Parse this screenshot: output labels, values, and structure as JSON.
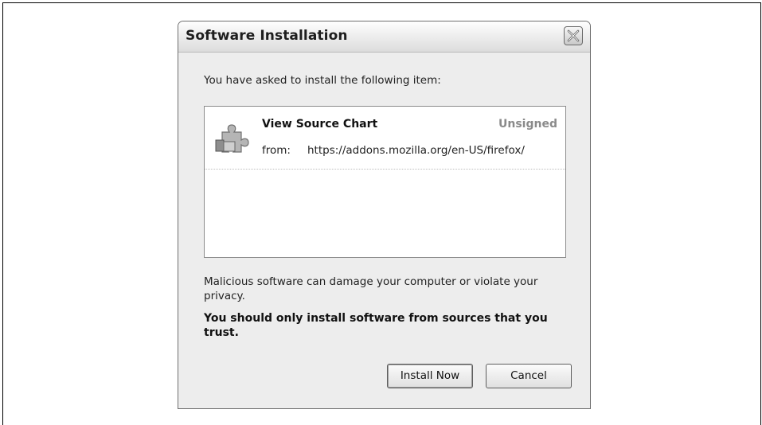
{
  "dialog": {
    "title": "Software Installation",
    "intro": "You have asked to install the following item:",
    "item": {
      "icon": "puzzle-piece-icon",
      "name": "View Source Chart",
      "status": "Unsigned",
      "from_label": "from:",
      "from_url": "https://addons.mozilla.org/en-US/firefox/"
    },
    "warning": "Malicious software can damage your computer or violate your privacy.",
    "warning_bold": "You should only install software from sources that you trust.",
    "buttons": {
      "install": "Install Now",
      "cancel": "Cancel"
    }
  },
  "colors": {
    "dialog_bg": "#ededed",
    "status_gray": "#8a8a8a"
  }
}
